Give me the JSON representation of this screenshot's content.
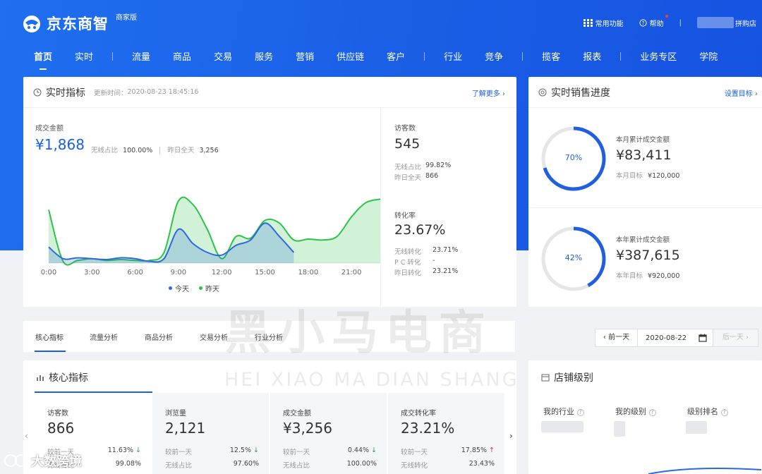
{
  "header": {
    "logo_text": "京东商智",
    "edition_badge": "商家版",
    "tools": [
      {
        "label": "常用功能",
        "icon": "grid-icon"
      },
      {
        "label": "帮助",
        "icon": "help-circle-icon"
      }
    ],
    "divider": "|",
    "shop_name": "拼购店"
  },
  "nav": [
    {
      "label": "首页",
      "active": true
    },
    {
      "label": "实时"
    },
    {
      "label": "流量"
    },
    {
      "label": "商品"
    },
    {
      "label": "交易"
    },
    {
      "label": "服务"
    },
    {
      "label": "营销"
    },
    {
      "label": "供应链"
    },
    {
      "label": "客户"
    },
    {
      "label": "行业"
    },
    {
      "label": "竞争"
    },
    {
      "label": "揽客"
    },
    {
      "label": "报表"
    },
    {
      "label": "业务专区"
    },
    {
      "label": "学院"
    }
  ],
  "realtime": {
    "title": "实时指标",
    "update_prefix": "更新时间：",
    "update_time": "2020-08-23 18:45:16",
    "more_link": "了解更多 ›",
    "gmv_label": "成交金额",
    "gmv_value": "¥1,868",
    "wireless_label": "无线占比",
    "wireless_value": "100.00%",
    "yesterday_label": "昨日全天",
    "yesterday_value": "3,256",
    "visitors": {
      "label": "访客数",
      "value": "545",
      "rows": [
        {
          "k": "无线占比",
          "v": "99.82%"
        },
        {
          "k": "昨日全天",
          "v": "866"
        }
      ]
    },
    "conversion": {
      "label": "转化率",
      "value": "23.67%",
      "rows": [
        {
          "k": "无线转化",
          "v": "23.71%"
        },
        {
          "k": "P C 转化",
          "v": "-"
        },
        {
          "k": "昨日转化",
          "v": "23.21%"
        }
      ]
    }
  },
  "chart_data": {
    "type": "area",
    "x_ticks": [
      "0:00",
      "3:00",
      "6:00",
      "9:00",
      "12:00",
      "15:00",
      "18:00",
      "21:00"
    ],
    "x_hours": [
      0,
      1,
      2,
      3,
      4,
      5,
      6,
      7,
      8,
      9,
      10,
      11,
      12,
      13,
      14,
      15,
      16,
      17,
      18,
      19,
      20,
      21,
      22,
      23
    ],
    "xlim": [
      0,
      23
    ],
    "ylim": [
      0,
      100
    ],
    "grid": false,
    "legend_position": "bottom",
    "series": [
      {
        "name": "今天",
        "color": "#2d68e0",
        "values": [
          18,
          5,
          6,
          5,
          4,
          6,
          5,
          2,
          5,
          38,
          22,
          12,
          9,
          20,
          26,
          45,
          30,
          12,
          null,
          null,
          null,
          null,
          null,
          null
        ]
      },
      {
        "name": "昨天",
        "color": "#2dc24a",
        "values": [
          60,
          2,
          3,
          5,
          3,
          4,
          3,
          3,
          12,
          70,
          66,
          38,
          5,
          30,
          28,
          48,
          45,
          26,
          27,
          26,
          30,
          52,
          68,
          72
        ]
      }
    ]
  },
  "sales_progress": {
    "title": "实时销售进度",
    "link": "设置目标 ›",
    "month": {
      "percent_label": "70%",
      "percent": 0.7,
      "label": "本月累计成交金额",
      "value": "¥83,411",
      "target_label": "本月目标",
      "target_value": "¥120,000"
    },
    "year": {
      "percent_label": "42%",
      "percent": 0.42,
      "label": "本年累计成交金额",
      "value": "¥387,615",
      "target_label": "本年目标",
      "target_value": "¥920,000"
    }
  },
  "tabs": [
    {
      "label": "核心指标",
      "active": true
    },
    {
      "label": "流量分析"
    },
    {
      "label": "商品分析"
    },
    {
      "label": "交易分析"
    },
    {
      "label": "行业分析"
    }
  ],
  "date_nav": {
    "prev": "‹ 前一天",
    "date": "2020-08-22",
    "next": "后一天 ›"
  },
  "core": {
    "title": "核心指标",
    "metrics": [
      {
        "label": "访客数",
        "value": "866",
        "r1k": "较前一天",
        "r1v": "11.63%",
        "dir": "down",
        "r2k": "无线占比",
        "r2v": "99.08%"
      },
      {
        "label": "浏览量",
        "value": "2,121",
        "r1k": "较前一天",
        "r1v": "12.5%",
        "dir": "down",
        "r2k": "无线占比",
        "r2v": "97.60%"
      },
      {
        "label": "成交金额",
        "value": "¥3,256",
        "r1k": "较前一天",
        "r1v": "0.44%",
        "dir": "down",
        "r2k": "无线占比",
        "r2v": "100.00%"
      },
      {
        "label": "成交转化率",
        "value": "23.21%",
        "r1k": "较前一天",
        "r1v": "17.85%",
        "dir": "up",
        "r2k": "无线转化",
        "r2v": "23.43%"
      }
    ]
  },
  "shop_level": {
    "title": "店铺级别",
    "cols": [
      "我的行业",
      "我的级别",
      "级别排名"
    ]
  },
  "watermark": {
    "cn": "黑小马电商",
    "en": "HEI XIAO MA DIAN SHANG",
    "corner": "大数跨境"
  }
}
